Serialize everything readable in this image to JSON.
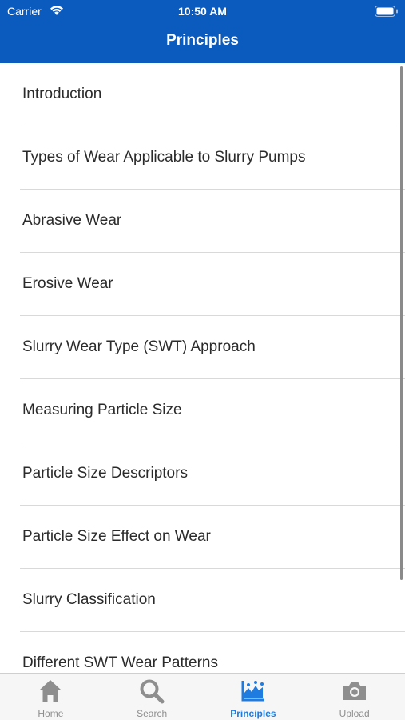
{
  "status_bar": {
    "carrier": "Carrier",
    "time": "10:50 AM"
  },
  "nav": {
    "title": "Principles"
  },
  "list": {
    "items": [
      {
        "label": "Introduction"
      },
      {
        "label": "Types of Wear Applicable to  Slurry Pumps"
      },
      {
        "label": "Abrasive Wear"
      },
      {
        "label": "Erosive Wear"
      },
      {
        "label": "Slurry Wear Type (SWT)  Approach"
      },
      {
        "label": "Measuring Particle Size"
      },
      {
        "label": "Particle Size Descriptors"
      },
      {
        "label": "Particle Size Effect on Wear"
      },
      {
        "label": "Slurry Classification"
      },
      {
        "label": "Different SWT Wear Patterns"
      }
    ]
  },
  "tabbar": {
    "tabs": [
      {
        "label": "Home",
        "icon": "home-icon"
      },
      {
        "label": "Search",
        "icon": "search-icon"
      },
      {
        "label": "Principles",
        "icon": "chart-icon",
        "active": true
      },
      {
        "label": "Upload",
        "icon": "camera-icon"
      }
    ]
  },
  "colors": {
    "header": "#0b5bbf",
    "tab_active": "#1e7be0",
    "tab_inactive": "#8e8e8e"
  }
}
